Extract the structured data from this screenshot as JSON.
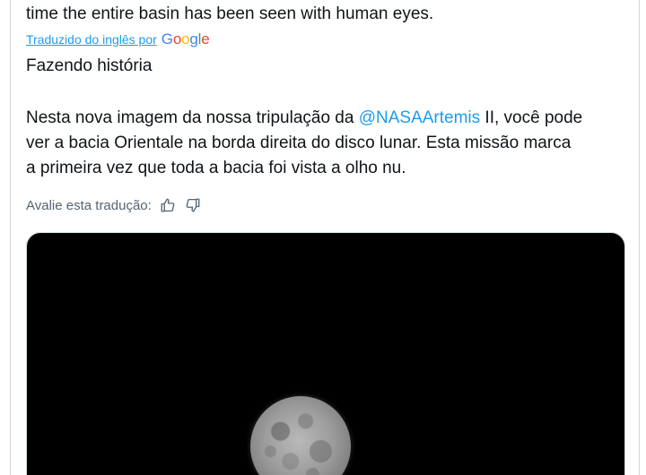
{
  "tweet": {
    "original_last_line": "time the entire basin has been seen with human eyes.",
    "translated_by_label": "Traduzido do inglês por",
    "translator_brand": "Google",
    "translated_title": "Fazendo história",
    "translated_body": {
      "line1_before": "Nesta nova imagem da nossa tripulação da ",
      "mention": "@NASAArtemis",
      "line1_after": " II, você pode",
      "line2": "ver a bacia Orientale na borda direita do disco lunar. Esta missão marca",
      "line3": "a primeira vez que toda a bacia foi vista a olho nu."
    },
    "rate_translation_label": "Avalie esta tradução:"
  },
  "icons": {
    "thumbs_up": "thumbs-up-icon",
    "thumbs_down": "thumbs-down-icon"
  },
  "colors": {
    "link": "#1d9bf0",
    "muted": "#536471",
    "text": "#0f1419",
    "media_bg": "#000000"
  }
}
